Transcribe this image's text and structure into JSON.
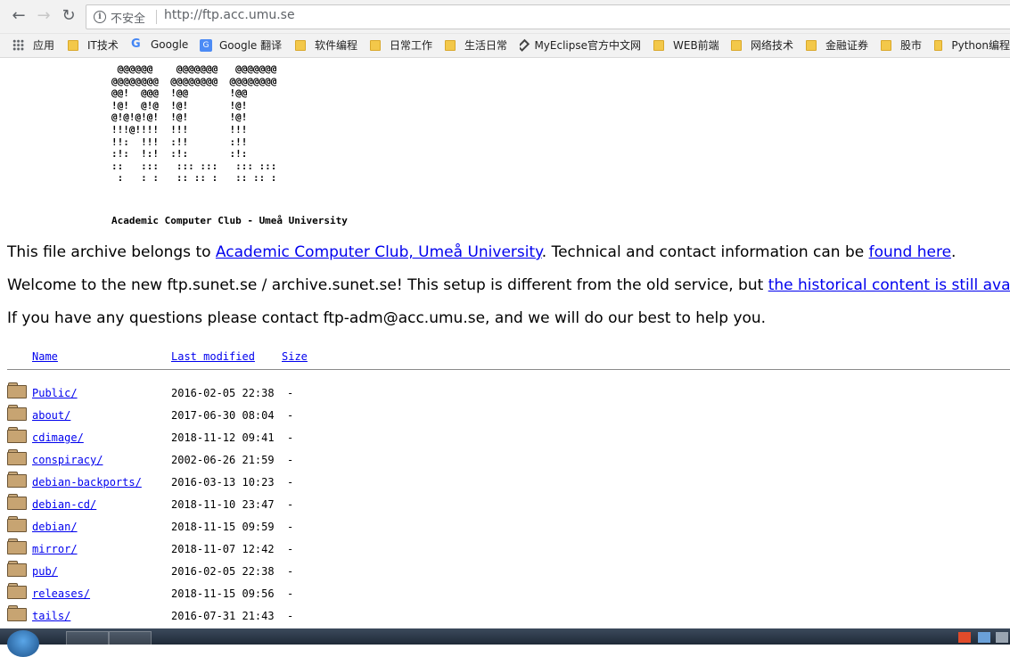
{
  "browser": {
    "security_label": "不安全",
    "url": "http://ftp.acc.umu.se",
    "back_glyph": "←",
    "forward_glyph": "→",
    "reload_glyph": "↻"
  },
  "bookmarks": [
    {
      "label": "应用",
      "icon": "apps-icon"
    },
    {
      "label": "IT技术",
      "icon": "folder-icon"
    },
    {
      "label": "Google",
      "icon": "google-icon"
    },
    {
      "label": "Google 翻译",
      "icon": "google-translate-icon"
    },
    {
      "label": "软件编程",
      "icon": "folder-icon"
    },
    {
      "label": "日常工作",
      "icon": "folder-icon"
    },
    {
      "label": "生活日常",
      "icon": "folder-icon"
    },
    {
      "label": "MyEclipse官方中文网",
      "icon": "myeclipse-icon"
    },
    {
      "label": "WEB前端",
      "icon": "folder-icon"
    },
    {
      "label": "网络技术",
      "icon": "folder-icon"
    },
    {
      "label": "金融证券",
      "icon": "folder-icon"
    },
    {
      "label": "股市",
      "icon": "folder-icon"
    },
    {
      "label": "Python编程",
      "icon": "folder-icon"
    }
  ],
  "page": {
    "ascii_banner": " @@@@@@    @@@@@@@   @@@@@@@\n@@@@@@@@  @@@@@@@@  @@@@@@@@\n@@!  @@@  !@@       !@@\n!@!  @!@  !@!       !@!\n@!@!@!@!  !@!       !@!\n!!!@!!!!  !!!       !!!\n!!:  !!!  :!!       :!!\n:!:  !:!  :!:       :!:\n::   :::   ::: :::   ::: :::\n :   : :   :: :: :   :: :: :",
    "banner_caption": "Academic Computer Club - Umeå University",
    "p1": {
      "text1": "This file archive belongs to ",
      "link1": "Academic Computer Club, Umeå University",
      "text2": ". Technical and contact information can be ",
      "link2": "found here",
      "text3": "."
    },
    "p2": {
      "text1": "Welcome to the new ftp.sunet.se / archive.sunet.se! This setup is different from the old service, but ",
      "link1": "the historical content is still available here",
      "text2": "."
    },
    "p3": "If you have any questions please contact ftp-adm@acc.umu.se, and we will do our best to help you."
  },
  "listing": {
    "columns": {
      "name": "Name",
      "modified": "Last modified",
      "size": "Size"
    },
    "rows": [
      {
        "name": "Public/",
        "modified": "2016-02-05 22:38",
        "size": "-"
      },
      {
        "name": "about/",
        "modified": "2017-06-30 08:04",
        "size": "-"
      },
      {
        "name": "cdimage/",
        "modified": "2018-11-12 09:41",
        "size": "-"
      },
      {
        "name": "conspiracy/",
        "modified": "2002-06-26 21:59",
        "size": "-"
      },
      {
        "name": "debian-backports/",
        "modified": "2016-03-13 10:23",
        "size": "-"
      },
      {
        "name": "debian-cd/",
        "modified": "2018-11-10 23:47",
        "size": "-"
      },
      {
        "name": "debian/",
        "modified": "2018-11-15 09:59",
        "size": "-"
      },
      {
        "name": "mirror/",
        "modified": "2018-11-07 12:42",
        "size": "-"
      },
      {
        "name": "pub/",
        "modified": "2016-02-05 22:38",
        "size": "-"
      },
      {
        "name": "releases/",
        "modified": "2018-11-15 09:56",
        "size": "-"
      },
      {
        "name": "tails/",
        "modified": "2016-07-31 21:43",
        "size": "-"
      }
    ]
  },
  "colors": {
    "link": "#0000ee",
    "folder": "#c7a472"
  }
}
